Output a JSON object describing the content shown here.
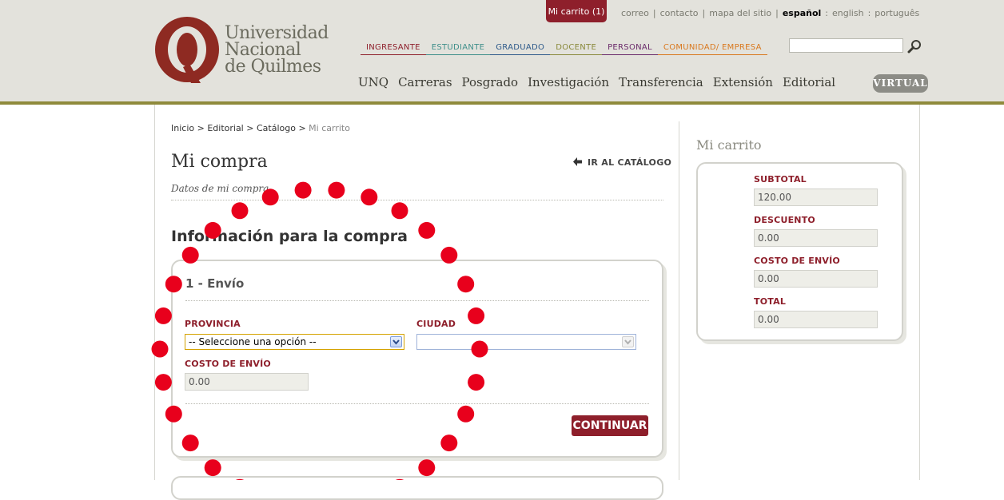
{
  "header": {
    "logo_lines": [
      "Universidad",
      "Nacional",
      "de Quilmes"
    ],
    "cart_pill": "Mi carrito (1)",
    "top_links": [
      "correo",
      "contacto",
      "mapa del sitio"
    ],
    "languages": {
      "active": "español",
      "others": [
        "english",
        "português"
      ]
    },
    "audience_nav": [
      {
        "label": "INGRESANTE",
        "color": "#8e1f2b"
      },
      {
        "label": "ESTUDIANTE",
        "color": "#3f8f8a"
      },
      {
        "label": "GRADUADO",
        "color": "#2e5a8a"
      },
      {
        "label": "DOCENTE",
        "color": "#8a8a3c"
      },
      {
        "label": "PERSONAL",
        "color": "#6a2a6a"
      },
      {
        "label": "COMUNIDAD/ EMPRESA",
        "color": "#d9781e"
      }
    ],
    "search_value": "",
    "main_nav": [
      "UNQ",
      "Carreras",
      "Posgrado",
      "Investigación",
      "Transferencia",
      "Extensión",
      "Editorial"
    ],
    "virtual_label": "VIRTUAL"
  },
  "breadcrumb": [
    "Inicio",
    "Editorial",
    "Catálogo",
    "Mi carrito"
  ],
  "page": {
    "title": "Mi compra",
    "back_link": "IR AL CATÁLOGO",
    "subtitle": "Datos de mi compra",
    "section_title": "Información para la compra"
  },
  "shipping": {
    "step_title": "1 - Envío",
    "provincia_label": "PROVINCIA",
    "provincia_value": "-- Seleccione una opción --",
    "ciudad_label": "CIUDAD",
    "ciudad_value": "",
    "costo_label": "COSTO DE ENVÍO",
    "costo_value": "0.00",
    "continue_label": "CONTINUAR"
  },
  "cart": {
    "title": "Mi carrito",
    "rows": [
      {
        "label": "SUBTOTAL",
        "value": "120.00"
      },
      {
        "label": "DESCUENTO",
        "value": "0.00"
      },
      {
        "label": "COSTO DE ENVÍO",
        "value": "0.00"
      },
      {
        "label": "TOTAL",
        "value": "0.00"
      }
    ]
  },
  "colors": {
    "brand": "#8e1f2b",
    "header_bg": "#e3e2dc",
    "header_bar": "#8f8a3c",
    "overlay_dot": "#e8001c"
  }
}
